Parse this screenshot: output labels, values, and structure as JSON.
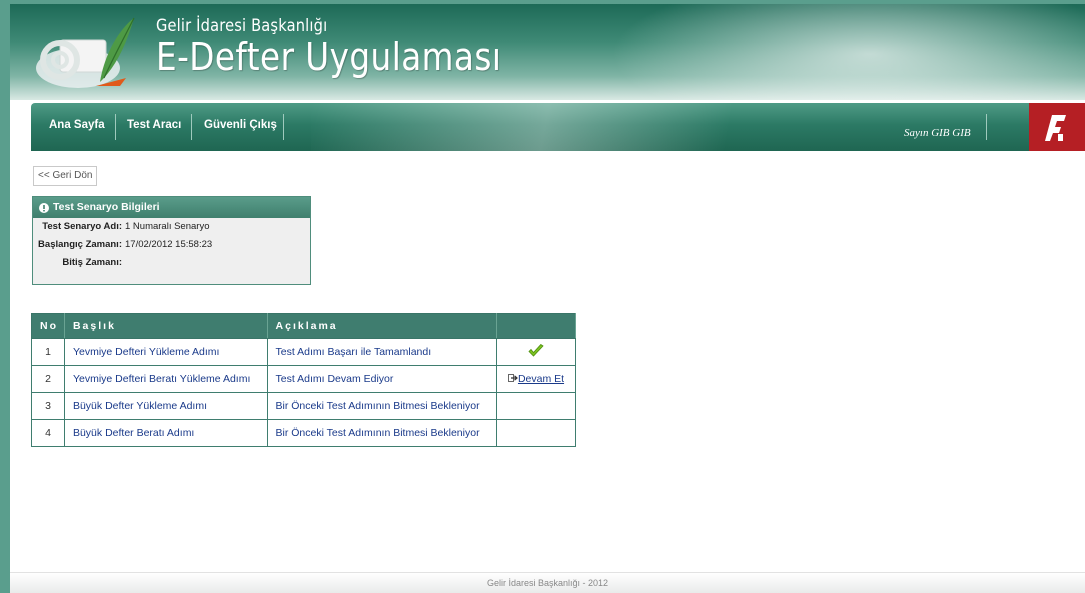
{
  "header": {
    "subtitle": "Gelir İdaresi Başkanlığı",
    "title": "E-Defter Uygulaması"
  },
  "nav": {
    "items": [
      {
        "label": "Ana Sayfa"
      },
      {
        "label": "Test Aracı"
      },
      {
        "label": "Güvenli Çıkış"
      }
    ],
    "user": "Sayın GIB GIB"
  },
  "back_button": "<< Geri Dön",
  "scenario": {
    "title": "Test Senaryo Bilgileri",
    "rows": [
      {
        "label": "Test Senaryo Adı:",
        "value": "1 Numaralı Senaryo"
      },
      {
        "label": "Başlangıç Zamanı:",
        "value": "17/02/2012 15:58:23"
      },
      {
        "label": "Bitiş Zamanı:",
        "value": ""
      }
    ]
  },
  "steps_table": {
    "headers": [
      "No",
      "Başlık",
      "Açıklama",
      ""
    ],
    "rows": [
      {
        "no": "1",
        "title": "Yevmiye Defteri Yükleme Adımı",
        "desc": "Test Adımı Başarı ile Tamamlandı",
        "action": "check"
      },
      {
        "no": "2",
        "title": "Yevmiye Defteri Beratı Yükleme Adımı",
        "desc": "Test Adımı Devam Ediyor",
        "action": "link",
        "action_label": "Devam Et"
      },
      {
        "no": "3",
        "title": "Büyük Defter Yükleme Adımı",
        "desc": "Bir Önceki Test Adımının Bitmesi Bekleniyor",
        "action": "none"
      },
      {
        "no": "4",
        "title": "Büyük Defter Beratı Adımı",
        "desc": "Bir Önceki Test Adımının Bitmesi Bekleniyor",
        "action": "none"
      }
    ]
  },
  "footer": "Gelir İdaresi Başkanlığı - 2012",
  "colors": {
    "primary": "#3f7d6f",
    "accent_red": "#b51f24",
    "link": "#1a3a8a",
    "check": "#7cc21f"
  },
  "icons": [
    "gib-logo-icon",
    "info-icon",
    "check-icon",
    "arrow-right-icon",
    "gib-brand-icon"
  ]
}
